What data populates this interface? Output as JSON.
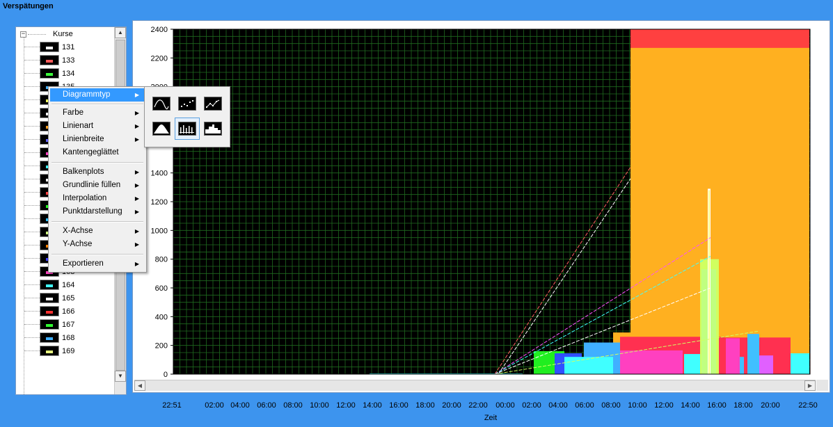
{
  "window": {
    "title": "Verspätungen"
  },
  "tree": {
    "root_label": "Kurse",
    "items": [
      {
        "label": "131",
        "color": "#ffffff"
      },
      {
        "label": "133",
        "color": "#ff5a5a"
      },
      {
        "label": "134",
        "color": "#3cff3c"
      },
      {
        "label": "135",
        "color": "#4ab4ff"
      },
      {
        "label": "",
        "color": "#f0ff60"
      },
      {
        "label": "",
        "color": "#ffffff"
      },
      {
        "label": "",
        "color": "#ff9f20"
      },
      {
        "label": "",
        "color": "#6666ff"
      },
      {
        "label": "",
        "color": "#ff40c0"
      },
      {
        "label": "",
        "color": "#40ffff"
      },
      {
        "label": "",
        "color": "#ffffff"
      },
      {
        "label": "",
        "color": "#ff4040"
      },
      {
        "label": "",
        "color": "#20ff20"
      },
      {
        "label": "",
        "color": "#30c0ff"
      },
      {
        "label": "",
        "color": "#d0ff80"
      },
      {
        "label": "",
        "color": "#ff8000"
      },
      {
        "label": "",
        "color": "#4040ff"
      },
      {
        "label": "163",
        "color": "#ff40c0"
      },
      {
        "label": "164",
        "color": "#40ffff"
      },
      {
        "label": "165",
        "color": "#ffffff"
      },
      {
        "label": "166",
        "color": "#ff3030"
      },
      {
        "label": "167",
        "color": "#30ff30"
      },
      {
        "label": "168",
        "color": "#40b0ff"
      },
      {
        "label": "169",
        "color": "#e8ff80"
      }
    ]
  },
  "context_menu": {
    "items": [
      {
        "label": "Diagrammtyp",
        "submenu": true,
        "active": true
      },
      {
        "label": "Farbe",
        "submenu": true
      },
      {
        "label": "Linienart",
        "submenu": true
      },
      {
        "label": "Linienbreite",
        "submenu": true
      },
      {
        "label": "Kantengeglättet",
        "submenu": false
      },
      {
        "label": "Balkenplots",
        "submenu": true
      },
      {
        "label": "Grundlinie füllen",
        "submenu": true
      },
      {
        "label": "Interpolation",
        "submenu": true
      },
      {
        "label": "Punktdarstellung",
        "submenu": true
      },
      {
        "label": "X-Achse",
        "submenu": true
      },
      {
        "label": "Y-Achse",
        "submenu": true
      },
      {
        "label": "Exportieren",
        "submenu": true
      }
    ],
    "submenu_icons": [
      {
        "name": "line-plot-icon"
      },
      {
        "name": "scatter-plot-icon"
      },
      {
        "name": "line-points-plot-icon"
      },
      {
        "name": "filled-plot-icon"
      },
      {
        "name": "bar-plot-icon",
        "selected": true
      },
      {
        "name": "step-plot-icon"
      }
    ]
  },
  "chart_data": {
    "type": "bar",
    "y_ticks": [
      0,
      200,
      400,
      600,
      800,
      1000,
      1200,
      1400,
      2000,
      2200,
      2400
    ],
    "x_ticks": [
      "22:51",
      "02:00",
      "04:00",
      "06:00",
      "08:00",
      "10:00",
      "12:00",
      "14:00",
      "16:00",
      "18:00",
      "20:00",
      "22:00",
      "00:00",
      "02:00",
      "04:00",
      "06:00",
      "08:00",
      "10:00",
      "12:00",
      "14:00",
      "16:00",
      "18:00",
      "20:00",
      "22:50"
    ],
    "xlabel": "Zeit",
    "ylim": [
      0,
      2400
    ],
    "grid": true,
    "colors": {
      "background": "#000000",
      "grid": "#1f6a1f"
    }
  }
}
